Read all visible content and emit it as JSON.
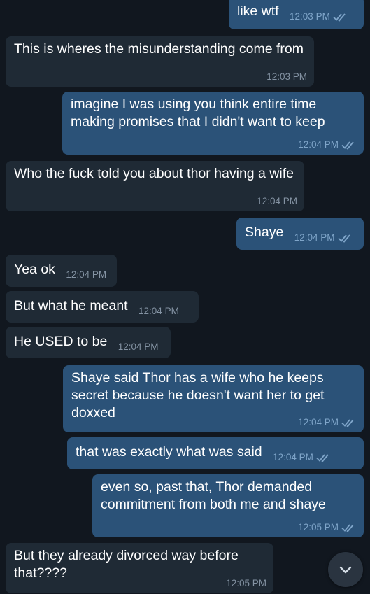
{
  "messages": [
    {
      "text": "like wtf",
      "time": "12:03 PM",
      "direction": "out",
      "read": true
    },
    {
      "text": "This is wheres the misunderstanding come from",
      "time": "12:03 PM",
      "direction": "in"
    },
    {
      "text": "imagine I was using you think entire time making promises that I didn't want to keep",
      "time": "12:04 PM",
      "direction": "out",
      "read": true
    },
    {
      "text": "Who the fuck told you about thor having a wife",
      "time": "12:04 PM",
      "direction": "in"
    },
    {
      "text": "Shaye",
      "time": "12:04 PM",
      "direction": "out",
      "read": true
    },
    {
      "text": "Yea ok",
      "time": "12:04 PM",
      "direction": "in"
    },
    {
      "text": "But what he meant",
      "time": "12:04 PM",
      "direction": "in"
    },
    {
      "text": "He USED to be",
      "time": "12:04 PM",
      "direction": "in"
    },
    {
      "text": "Shaye said Thor has a wife who he keeps secret because he doesn't want her to get doxxed",
      "time": "12:04 PM",
      "direction": "out",
      "read": true
    },
    {
      "text": "that was exactly what was said",
      "time": "12:04 PM",
      "direction": "out",
      "read": true
    },
    {
      "text": "even so, past that, Thor demanded commitment from both me and shaye",
      "time": "12:05 PM",
      "direction": "out",
      "read": true
    },
    {
      "text": "But they already divorced way before that????",
      "time": "12:05 PM",
      "direction": "in"
    }
  ],
  "colors": {
    "background": "#11171f",
    "incoming_bubble": "#1f2a35",
    "outgoing_bubble": "#2b5278",
    "read_check": "#7fa5c9"
  },
  "icons": {
    "read_status": "double-check-icon",
    "scroll_button": "chevron-down-icon"
  }
}
